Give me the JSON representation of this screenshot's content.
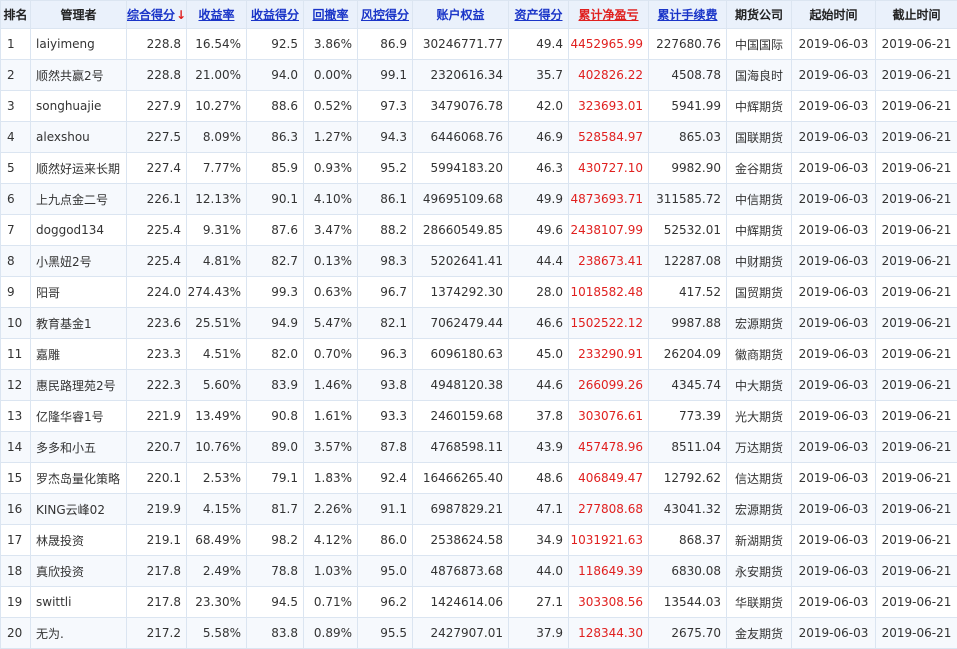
{
  "columns": [
    {
      "label": "排名",
      "sortable": false
    },
    {
      "label": "管理者",
      "sortable": false
    },
    {
      "label": "综合得分",
      "sortable": true,
      "sorted_desc": true,
      "sort_indicator": "↓"
    },
    {
      "label": "收益率",
      "sortable": true
    },
    {
      "label": "收益得分",
      "sortable": true
    },
    {
      "label": "回撤率",
      "sortable": true
    },
    {
      "label": "风控得分",
      "sortable": true
    },
    {
      "label": "账户权益",
      "sortable": false,
      "color": "blue"
    },
    {
      "label": "资产得分",
      "sortable": true
    },
    {
      "label": "累计净盈亏",
      "sortable": true,
      "color": "red"
    },
    {
      "label": "累计手续费",
      "sortable": true
    },
    {
      "label": "期货公司",
      "sortable": false
    },
    {
      "label": "起始时间",
      "sortable": false
    },
    {
      "label": "截止时间",
      "sortable": false
    }
  ],
  "rows": [
    {
      "rank": "1",
      "manager": "laiyimeng",
      "score": "228.8",
      "return_rate": "16.54%",
      "return_score": "92.5",
      "drawdown": "3.86%",
      "risk_score": "86.9",
      "equity": "30246771.77",
      "asset_score": "49.4",
      "net_pnl": "4452965.99",
      "fees": "227680.76",
      "company": "中国国际",
      "start": "2019-06-03",
      "end": "2019-06-21"
    },
    {
      "rank": "2",
      "manager": "顺然共赢2号",
      "score": "228.8",
      "return_rate": "21.00%",
      "return_score": "94.0",
      "drawdown": "0.00%",
      "risk_score": "99.1",
      "equity": "2320616.34",
      "asset_score": "35.7",
      "net_pnl": "402826.22",
      "fees": "4508.78",
      "company": "国海良时",
      "start": "2019-06-03",
      "end": "2019-06-21"
    },
    {
      "rank": "3",
      "manager": "songhuajie",
      "score": "227.9",
      "return_rate": "10.27%",
      "return_score": "88.6",
      "drawdown": "0.52%",
      "risk_score": "97.3",
      "equity": "3479076.78",
      "asset_score": "42.0",
      "net_pnl": "323693.01",
      "fees": "5941.99",
      "company": "中辉期货",
      "start": "2019-06-03",
      "end": "2019-06-21"
    },
    {
      "rank": "4",
      "manager": "alexshou",
      "score": "227.5",
      "return_rate": "8.09%",
      "return_score": "86.3",
      "drawdown": "1.27%",
      "risk_score": "94.3",
      "equity": "6446068.76",
      "asset_score": "46.9",
      "net_pnl": "528584.97",
      "fees": "865.03",
      "company": "国联期货",
      "start": "2019-06-03",
      "end": "2019-06-21"
    },
    {
      "rank": "5",
      "manager": "顺然好运来长期",
      "score": "227.4",
      "return_rate": "7.77%",
      "return_score": "85.9",
      "drawdown": "0.93%",
      "risk_score": "95.2",
      "equity": "5994183.20",
      "asset_score": "46.3",
      "net_pnl": "430727.10",
      "fees": "9982.90",
      "company": "金谷期货",
      "start": "2019-06-03",
      "end": "2019-06-21"
    },
    {
      "rank": "6",
      "manager": "上九点金二号",
      "score": "226.1",
      "return_rate": "12.13%",
      "return_score": "90.1",
      "drawdown": "4.10%",
      "risk_score": "86.1",
      "equity": "49695109.68",
      "asset_score": "49.9",
      "net_pnl": "4873693.71",
      "fees": "311585.72",
      "company": "中信期货",
      "start": "2019-06-03",
      "end": "2019-06-21"
    },
    {
      "rank": "7",
      "manager": "doggod134",
      "score": "225.4",
      "return_rate": "9.31%",
      "return_score": "87.6",
      "drawdown": "3.47%",
      "risk_score": "88.2",
      "equity": "28660549.85",
      "asset_score": "49.6",
      "net_pnl": "2438107.99",
      "fees": "52532.01",
      "company": "中辉期货",
      "start": "2019-06-03",
      "end": "2019-06-21"
    },
    {
      "rank": "8",
      "manager": "小黑妞2号",
      "score": "225.4",
      "return_rate": "4.81%",
      "return_score": "82.7",
      "drawdown": "0.13%",
      "risk_score": "98.3",
      "equity": "5202641.41",
      "asset_score": "44.4",
      "net_pnl": "238673.41",
      "fees": "12287.08",
      "company": "中财期货",
      "start": "2019-06-03",
      "end": "2019-06-21"
    },
    {
      "rank": "9",
      "manager": "阳哥",
      "score": "224.0",
      "return_rate": "274.43%",
      "return_score": "99.3",
      "drawdown": "0.63%",
      "risk_score": "96.7",
      "equity": "1374292.30",
      "asset_score": "28.0",
      "net_pnl": "1018582.48",
      "fees": "417.52",
      "company": "国贸期货",
      "start": "2019-06-03",
      "end": "2019-06-21"
    },
    {
      "rank": "10",
      "manager": "教育基金1",
      "score": "223.6",
      "return_rate": "25.51%",
      "return_score": "94.9",
      "drawdown": "5.47%",
      "risk_score": "82.1",
      "equity": "7062479.44",
      "asset_score": "46.6",
      "net_pnl": "1502522.12",
      "fees": "9987.88",
      "company": "宏源期货",
      "start": "2019-06-03",
      "end": "2019-06-21"
    },
    {
      "rank": "11",
      "manager": "嘉雕",
      "score": "223.3",
      "return_rate": "4.51%",
      "return_score": "82.0",
      "drawdown": "0.70%",
      "risk_score": "96.3",
      "equity": "6096180.63",
      "asset_score": "45.0",
      "net_pnl": "233290.91",
      "fees": "26204.09",
      "company": "徽商期货",
      "start": "2019-06-03",
      "end": "2019-06-21"
    },
    {
      "rank": "12",
      "manager": "惠民路理苑2号",
      "score": "222.3",
      "return_rate": "5.60%",
      "return_score": "83.9",
      "drawdown": "1.46%",
      "risk_score": "93.8",
      "equity": "4948120.38",
      "asset_score": "44.6",
      "net_pnl": "266099.26",
      "fees": "4345.74",
      "company": "中大期货",
      "start": "2019-06-03",
      "end": "2019-06-21"
    },
    {
      "rank": "13",
      "manager": "亿隆华睿1号",
      "score": "221.9",
      "return_rate": "13.49%",
      "return_score": "90.8",
      "drawdown": "1.61%",
      "risk_score": "93.3",
      "equity": "2460159.68",
      "asset_score": "37.8",
      "net_pnl": "303076.61",
      "fees": "773.39",
      "company": "光大期货",
      "start": "2019-06-03",
      "end": "2019-06-21"
    },
    {
      "rank": "14",
      "manager": "多多和小五",
      "score": "220.7",
      "return_rate": "10.76%",
      "return_score": "89.0",
      "drawdown": "3.57%",
      "risk_score": "87.8",
      "equity": "4768598.11",
      "asset_score": "43.9",
      "net_pnl": "457478.96",
      "fees": "8511.04",
      "company": "万达期货",
      "start": "2019-06-03",
      "end": "2019-06-21"
    },
    {
      "rank": "15",
      "manager": "罗杰岛量化策略",
      "score": "220.1",
      "return_rate": "2.53%",
      "return_score": "79.1",
      "drawdown": "1.83%",
      "risk_score": "92.4",
      "equity": "16466265.40",
      "asset_score": "48.6",
      "net_pnl": "406849.47",
      "fees": "12792.62",
      "company": "信达期货",
      "start": "2019-06-03",
      "end": "2019-06-21"
    },
    {
      "rank": "16",
      "manager": "KING云峰02",
      "score": "219.9",
      "return_rate": "4.15%",
      "return_score": "81.7",
      "drawdown": "2.26%",
      "risk_score": "91.1",
      "equity": "6987829.21",
      "asset_score": "47.1",
      "net_pnl": "277808.68",
      "fees": "43041.32",
      "company": "宏源期货",
      "start": "2019-06-03",
      "end": "2019-06-21"
    },
    {
      "rank": "17",
      "manager": "林晟投资",
      "score": "219.1",
      "return_rate": "68.49%",
      "return_score": "98.2",
      "drawdown": "4.12%",
      "risk_score": "86.0",
      "equity": "2538624.58",
      "asset_score": "34.9",
      "net_pnl": "1031921.63",
      "fees": "868.37",
      "company": "新湖期货",
      "start": "2019-06-03",
      "end": "2019-06-21"
    },
    {
      "rank": "18",
      "manager": "真欣投资",
      "score": "217.8",
      "return_rate": "2.49%",
      "return_score": "78.8",
      "drawdown": "1.03%",
      "risk_score": "95.0",
      "equity": "4876873.68",
      "asset_score": "44.0",
      "net_pnl": "118649.39",
      "fees": "6830.08",
      "company": "永安期货",
      "start": "2019-06-03",
      "end": "2019-06-21"
    },
    {
      "rank": "19",
      "manager": "swittli",
      "score": "217.8",
      "return_rate": "23.30%",
      "return_score": "94.5",
      "drawdown": "0.71%",
      "risk_score": "96.2",
      "equity": "1424614.06",
      "asset_score": "27.1",
      "net_pnl": "303308.56",
      "fees": "13544.03",
      "company": "华联期货",
      "start": "2019-06-03",
      "end": "2019-06-21"
    },
    {
      "rank": "20",
      "manager": "无为.",
      "score": "217.2",
      "return_rate": "5.58%",
      "return_score": "83.8",
      "drawdown": "0.89%",
      "risk_score": "95.5",
      "equity": "2427907.01",
      "asset_score": "37.9",
      "net_pnl": "128344.30",
      "fees": "2675.70",
      "company": "金友期货",
      "start": "2019-06-03",
      "end": "2019-06-21"
    }
  ]
}
